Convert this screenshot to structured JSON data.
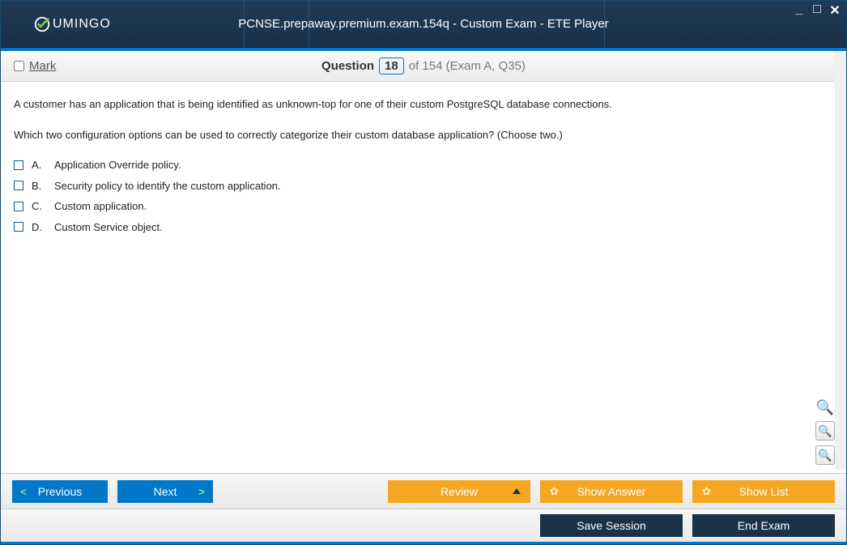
{
  "app": {
    "brand": "UMINGO",
    "title": "PCNSE.prepaway.premium.exam.154q - Custom Exam - ETE Player"
  },
  "header": {
    "mark_label": "Mark",
    "question_word": "Question",
    "question_number": "18",
    "of_text": "of 154 (Exam A, Q35)"
  },
  "question": {
    "stem1": "A customer has an application that is being identified as unknown-top for one of their custom PostgreSQL database connections.",
    "stem2": "Which two configuration options can be used to correctly categorize their custom database application? (Choose two.)",
    "options": [
      {
        "letter": "A.",
        "text": "Application Override policy."
      },
      {
        "letter": "B.",
        "text": "Security policy to identify the custom application."
      },
      {
        "letter": "C.",
        "text": "Custom application."
      },
      {
        "letter": "D.",
        "text": "Custom Service object."
      }
    ]
  },
  "footer": {
    "previous": "Previous",
    "next": "Next",
    "review": "Review",
    "show_answer": "Show Answer",
    "show_list": "Show List",
    "save_session": "Save Session",
    "end_exam": "End Exam"
  }
}
